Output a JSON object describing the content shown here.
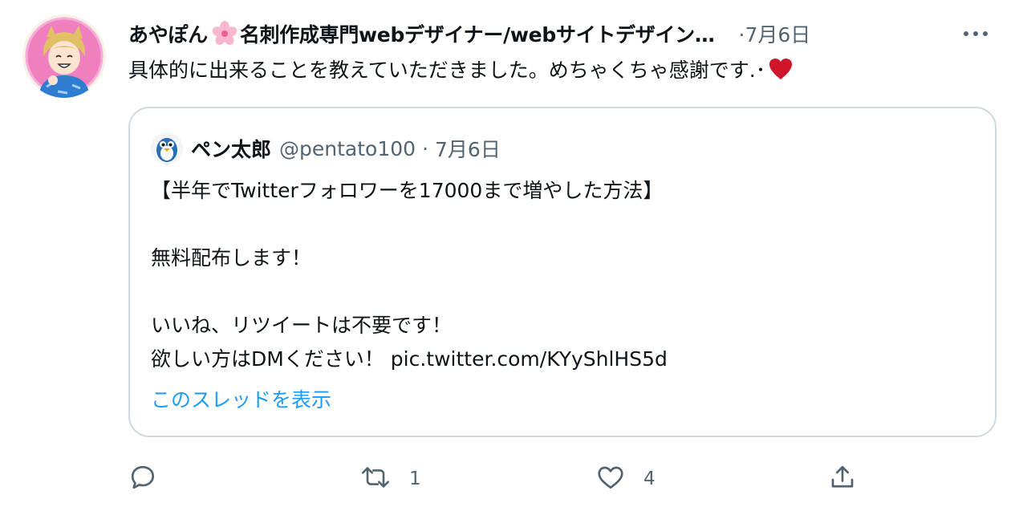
{
  "tweet": {
    "author_name_part1": "あやぽん",
    "author_name_part2": "名刺作成専門webデザイナー/webサイトデザイン…",
    "dot": "·",
    "date": "7月6日",
    "text": "具体的に出来ることを教えていただきました。めちゃくちゃ感謝です.･",
    "icons": {
      "flower": "cherry-blossom-icon",
      "heart": "red-heart-icon",
      "more": "more-icon"
    }
  },
  "quote": {
    "author_name": "ペン太郎",
    "handle": "@pentato100",
    "separator": "·",
    "date": "7月6日",
    "body": "【半年でTwitterフォロワーを17000まで増やした方法】\n\n無料配布します！\n\nいいね、リツイートは不要です！\n欲しい方はDMください！ pic.twitter.com/KYyShlHS5d",
    "show_thread": "このスレッドを表示"
  },
  "actions": {
    "reply_count": "",
    "retweet_count": "1",
    "like_count": "4",
    "icons": [
      "reply-icon",
      "retweet-icon",
      "like-icon",
      "share-icon"
    ]
  },
  "colors": {
    "text": "#0f1419",
    "secondary": "#536471",
    "link": "#1d9bf0",
    "heart": "#d0152a",
    "border": "#cfd9de"
  }
}
